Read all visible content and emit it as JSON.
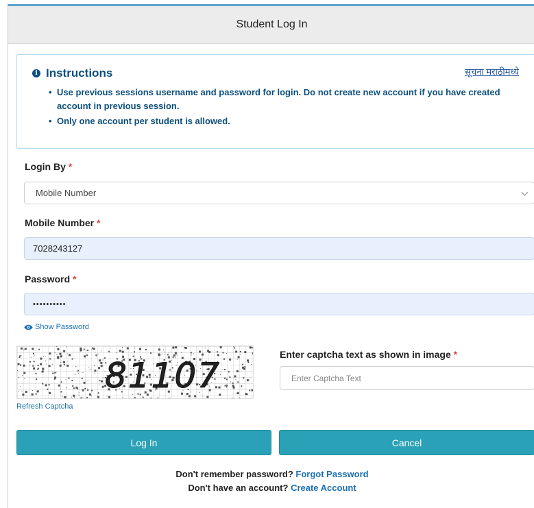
{
  "header": {
    "title": "Student Log In"
  },
  "instructions": {
    "title": "Instructions",
    "marathi_link": "सूचना मराठीमध्ये",
    "items": [
      "Use previous sessions username and password for login. Do not create new account if you have created account in previous session.",
      "Only one account per student is allowed."
    ]
  },
  "login_by": {
    "label": "Login By",
    "required_mark": "*",
    "selected": "Mobile Number"
  },
  "mobile": {
    "label": "Mobile Number",
    "required_mark": "*",
    "value": "7028243127"
  },
  "password": {
    "label": "Password",
    "required_mark": "*",
    "masked_value": "••••••••••",
    "show_label": "Show Password"
  },
  "captcha": {
    "image_text": "81107",
    "refresh_label": "Refresh Captcha",
    "input_label": "Enter captcha text as shown in image",
    "required_mark": "*",
    "placeholder": "Enter Captcha Text"
  },
  "buttons": {
    "login": "Log In",
    "cancel": "Cancel"
  },
  "footer": {
    "forgot_prompt": "Don't remember password?",
    "forgot_link": "Forgot Password",
    "create_prompt": "Don't have an account?",
    "create_link": "Create Account"
  },
  "colors": {
    "accent": "#2aa1b6",
    "instructions_text": "#0d4f7e",
    "link": "#1b6fb5",
    "required": "#d9463e",
    "autofill_bg": "#e8f0fe"
  },
  "icons": {
    "info": "info-circle-icon",
    "eye": "eye-icon",
    "chevron": "chevron-down-icon"
  }
}
